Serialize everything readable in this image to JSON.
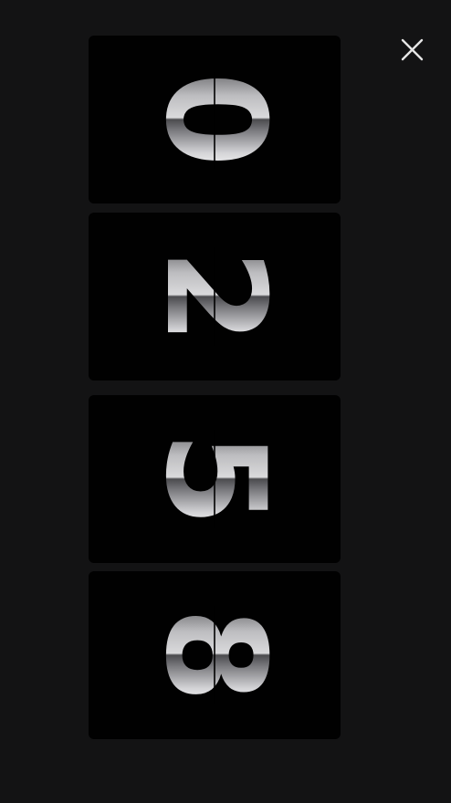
{
  "clock": {
    "digits": [
      {
        "value": "0"
      },
      {
        "value": "2"
      },
      {
        "value": "5"
      },
      {
        "value": "8"
      }
    ]
  },
  "icons": {
    "close": "close-icon"
  },
  "colors": {
    "background": "#131314",
    "card": "#010101",
    "digit_light": "#e8e8ea",
    "digit_mid": "#8a8a8d",
    "digit_dark": "#5d5d60",
    "close_icon": "#e6e6e6"
  }
}
